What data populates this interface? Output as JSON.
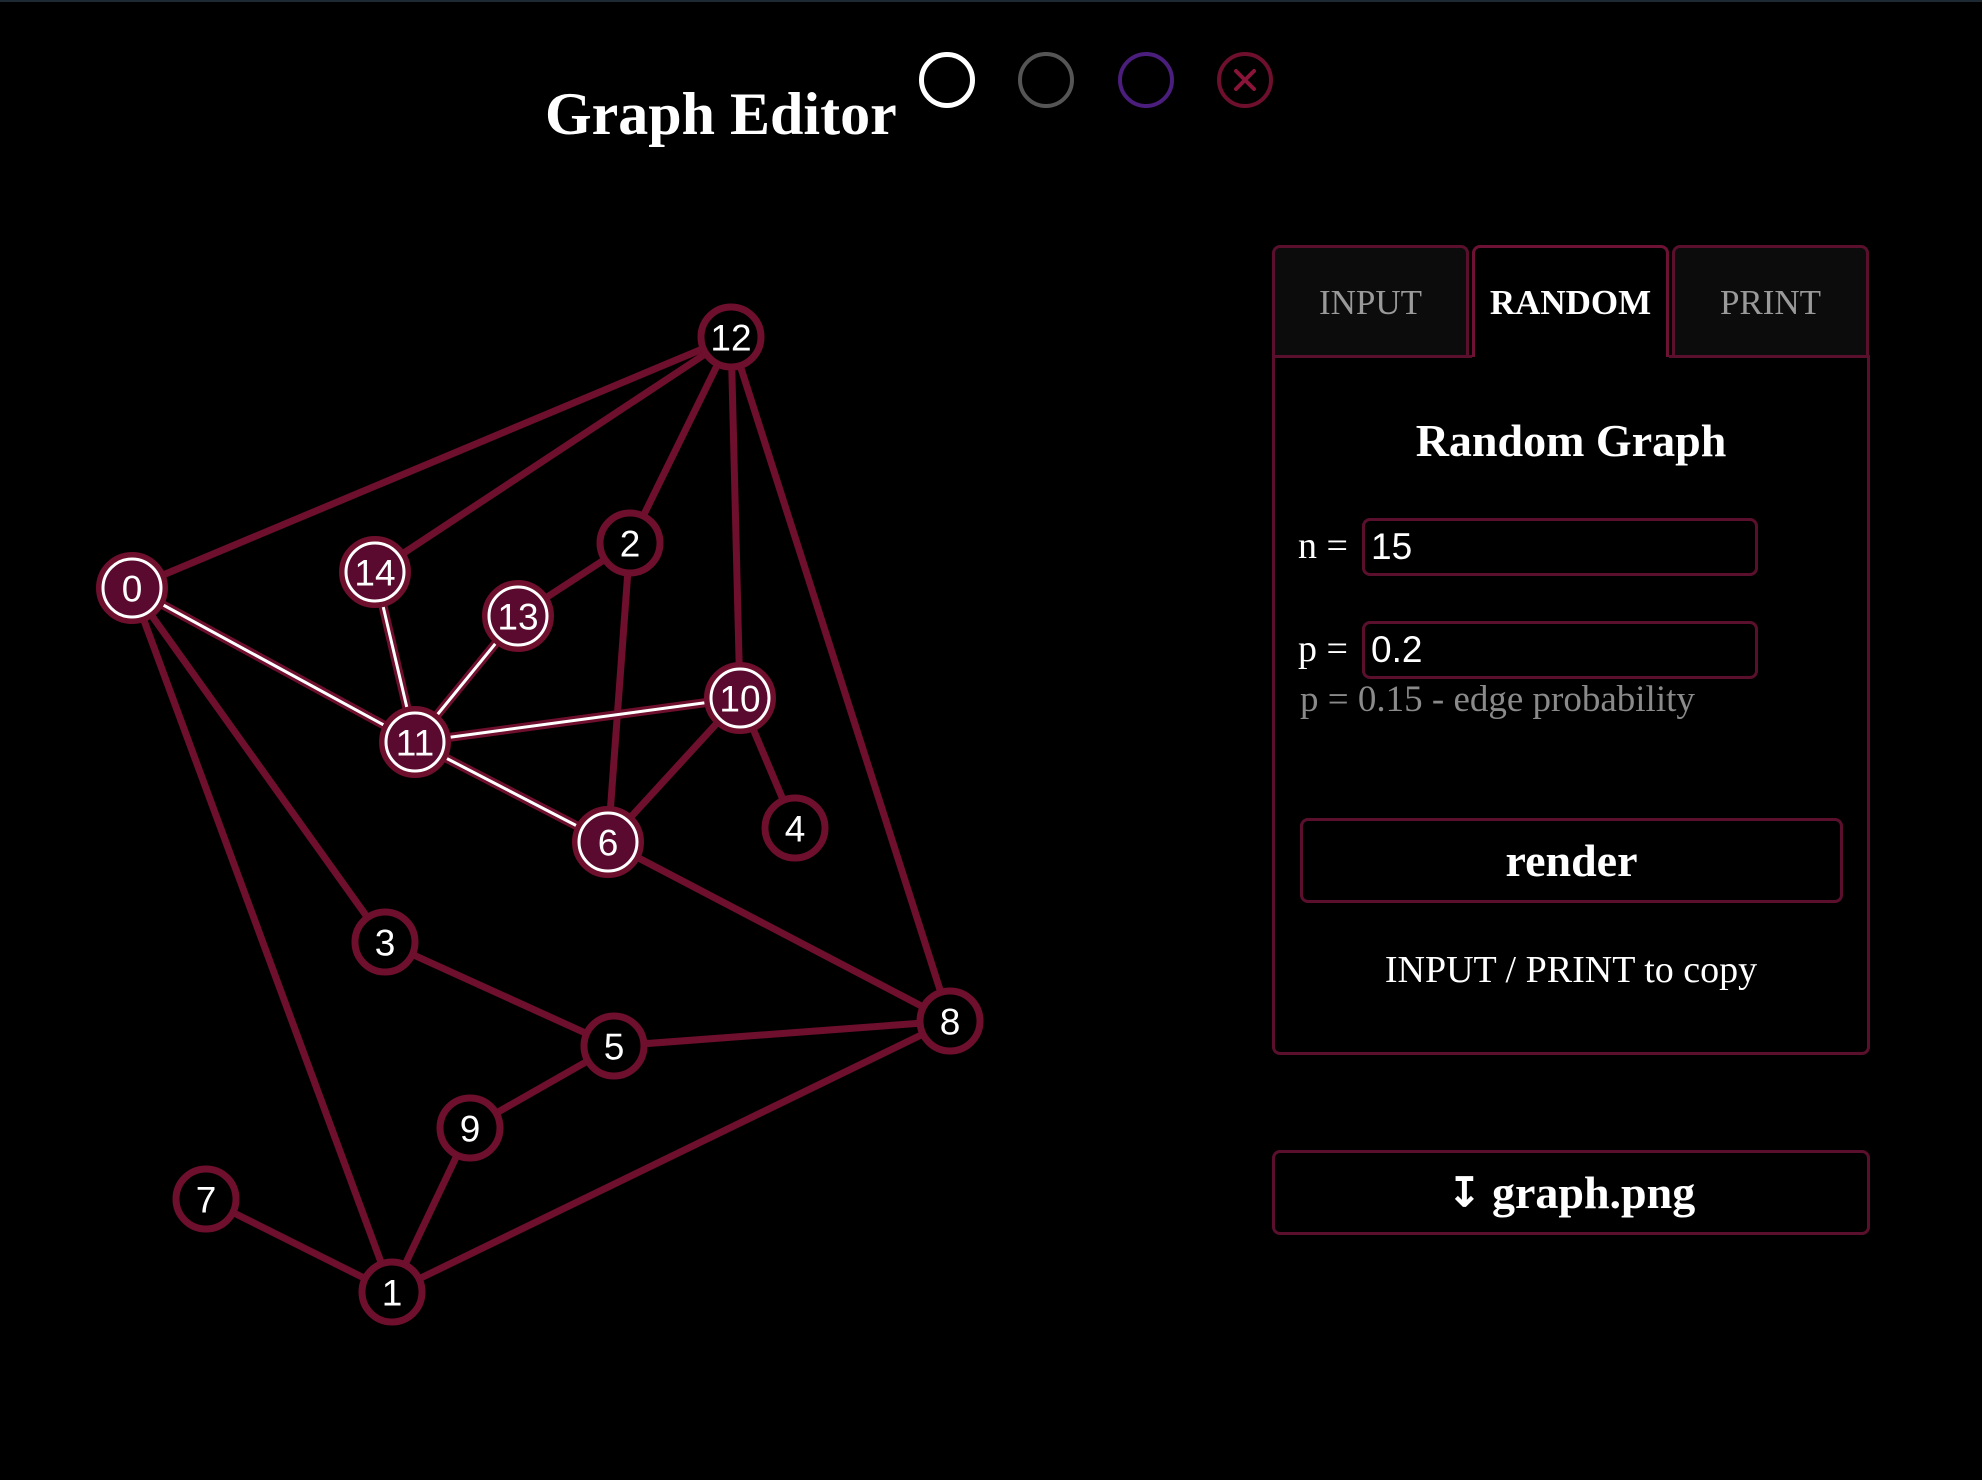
{
  "app": {
    "title": "Graph Editor"
  },
  "theme_buttons": [
    {
      "name": "theme-white"
    },
    {
      "name": "theme-gray"
    },
    {
      "name": "theme-purple"
    },
    {
      "name": "close",
      "icon": "close-icon"
    }
  ],
  "colors": {
    "background": "#000000",
    "accent": "#6e0f2d",
    "node_fill": "#5a0a2e",
    "highlight": "#ffffff",
    "text": "#ffffff",
    "muted": "#8a8a8a"
  },
  "tabs": [
    {
      "label": "INPUT",
      "active": false
    },
    {
      "label": "RANDOM",
      "active": true
    },
    {
      "label": "PRINT",
      "active": false
    }
  ],
  "random_panel": {
    "title": "Random Graph",
    "n_label": "n =",
    "n_value": "15",
    "p_label": "p =",
    "p_value": "0.2",
    "p_hint": "p = 0.15 - edge probability",
    "render_label": "render",
    "copy_note": "INPUT / PRINT to copy"
  },
  "download": {
    "icon": "download-arrow-icon",
    "label": "graph.png"
  },
  "graph": {
    "nodes": [
      {
        "id": "0",
        "highlighted": true
      },
      {
        "id": "1",
        "highlighted": false
      },
      {
        "id": "2",
        "highlighted": false
      },
      {
        "id": "3",
        "highlighted": false
      },
      {
        "id": "4",
        "highlighted": false
      },
      {
        "id": "5",
        "highlighted": false
      },
      {
        "id": "6",
        "highlighted": true
      },
      {
        "id": "7",
        "highlighted": false
      },
      {
        "id": "8",
        "highlighted": false
      },
      {
        "id": "9",
        "highlighted": false
      },
      {
        "id": "10",
        "highlighted": true
      },
      {
        "id": "11",
        "highlighted": true
      },
      {
        "id": "12",
        "highlighted": false
      },
      {
        "id": "13",
        "highlighted": true
      },
      {
        "id": "14",
        "highlighted": true
      }
    ],
    "edges": [
      {
        "from": "0",
        "to": "12",
        "highlighted": false
      },
      {
        "from": "0",
        "to": "11",
        "highlighted": true
      },
      {
        "from": "0",
        "to": "3",
        "highlighted": false
      },
      {
        "from": "0",
        "to": "1",
        "highlighted": false
      },
      {
        "from": "14",
        "to": "12",
        "highlighted": false
      },
      {
        "from": "14",
        "to": "11",
        "highlighted": true
      },
      {
        "from": "13",
        "to": "11",
        "highlighted": true
      },
      {
        "from": "13",
        "to": "2",
        "highlighted": false
      },
      {
        "from": "2",
        "to": "12",
        "highlighted": false
      },
      {
        "from": "2",
        "to": "6",
        "highlighted": false
      },
      {
        "from": "12",
        "to": "10",
        "highlighted": false
      },
      {
        "from": "12",
        "to": "8",
        "highlighted": false
      },
      {
        "from": "11",
        "to": "10",
        "highlighted": true
      },
      {
        "from": "11",
        "to": "6",
        "highlighted": true
      },
      {
        "from": "10",
        "to": "6",
        "highlighted": false
      },
      {
        "from": "10",
        "to": "4",
        "highlighted": false
      },
      {
        "from": "6",
        "to": "8",
        "highlighted": false
      },
      {
        "from": "3",
        "to": "5",
        "highlighted": false
      },
      {
        "from": "5",
        "to": "8",
        "highlighted": false
      },
      {
        "from": "5",
        "to": "9",
        "highlighted": false
      },
      {
        "from": "9",
        "to": "1",
        "highlighted": false
      },
      {
        "from": "7",
        "to": "1",
        "highlighted": false
      },
      {
        "from": "1",
        "to": "8",
        "highlighted": false
      }
    ]
  }
}
